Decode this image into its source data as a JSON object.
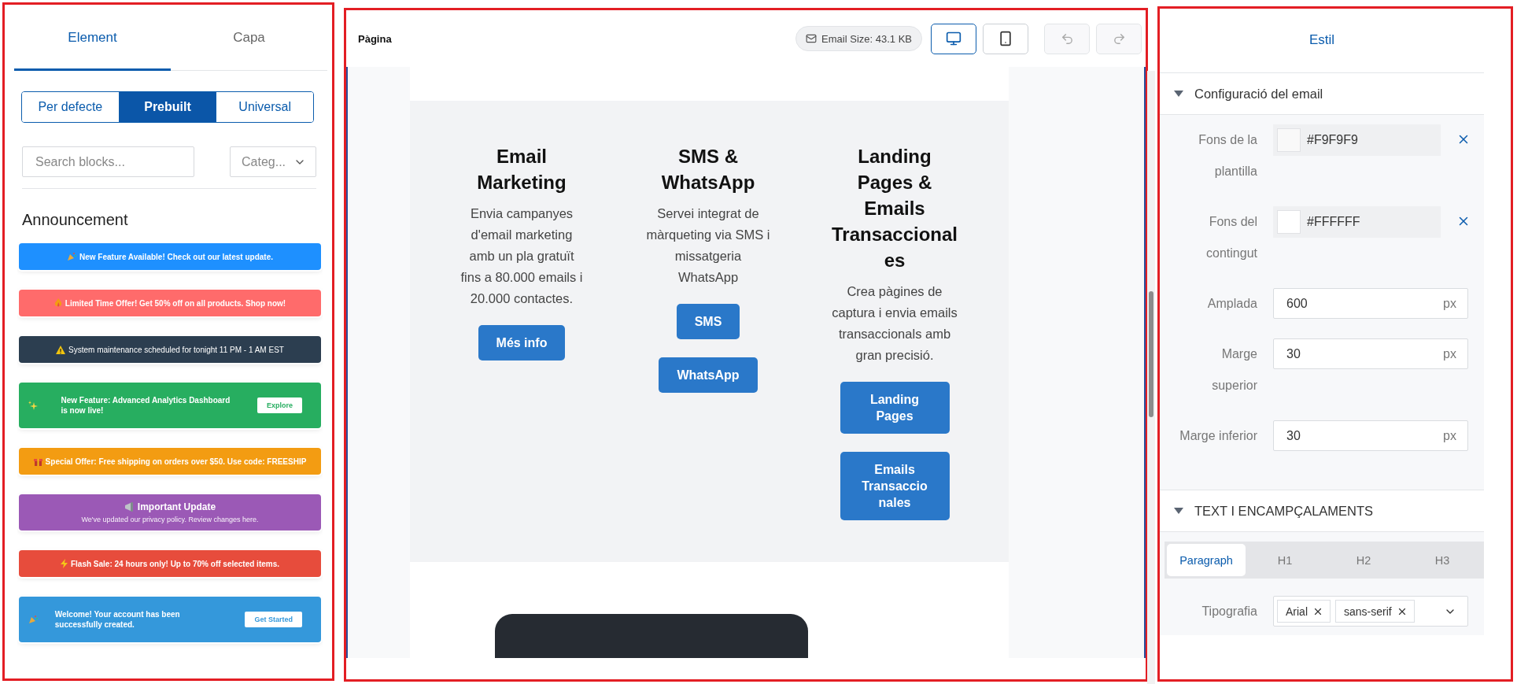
{
  "left_panel": {
    "tabs": [
      {
        "label": "Element",
        "selected": true
      },
      {
        "label": "Capa",
        "selected": false
      }
    ],
    "block_sources": [
      {
        "label": "Per defecte",
        "selected": false
      },
      {
        "label": "Prebuilt",
        "selected": true
      },
      {
        "label": "Universal",
        "selected": false
      }
    ],
    "search": {
      "placeholder": "Search blocks..."
    },
    "category_select": {
      "placeholder": "Categ..."
    },
    "section_title": "Announcement",
    "blocks": [
      {
        "kind": "bar",
        "color": "#1e90ff",
        "bold": true,
        "text": "New Feature Available! Check out our latest update."
      },
      {
        "kind": "bar",
        "color": "#ff6b6b",
        "bold": true,
        "text": "Limited Time Offer! Get 50% off on all products. Shop now!"
      },
      {
        "kind": "bar",
        "color": "#2c3e50",
        "bold": false,
        "text": "System maintenance scheduled for tonight 11 PM - 1 AM EST"
      },
      {
        "kind": "cta",
        "color": "#27ae60",
        "bold": true,
        "text": "New Feature: Advanced Analytics Dashboard is now live!",
        "button": "Explore"
      },
      {
        "kind": "bar",
        "color": "#f39c12",
        "bold": true,
        "text": "Special Offer: Free shipping on orders over $50. Use code: FREESHIP"
      },
      {
        "kind": "titled",
        "color": "#9b59b6",
        "bold": true,
        "text": "Important Update",
        "subtitle": "We've updated our privacy policy. Review changes here."
      },
      {
        "kind": "bar",
        "color": "#e74c3c",
        "bold": true,
        "text": "Flash Sale: 24 hours only! Up to 70% off selected items."
      },
      {
        "kind": "cta",
        "color": "#3498db",
        "bold": true,
        "text": "Welcome! Your account has been successfully created.",
        "button": "Get Started"
      }
    ]
  },
  "canvas": {
    "title": "Pàgina",
    "email_size": "Email Size: 43.1 KB",
    "view_modes": [
      {
        "kind": "desktop",
        "selected": true
      },
      {
        "kind": "mobile",
        "selected": false
      }
    ],
    "history_buttons": [
      {
        "kind": "undo",
        "disabled": true
      },
      {
        "kind": "redo",
        "disabled": true
      }
    ],
    "email_columns": [
      {
        "title": "Email Marketing",
        "text": "Envia campanyes d'email marketing amb un pla gratuït fins a 80.000 emails i 20.000 contactes.",
        "buttons": [
          "Més info"
        ]
      },
      {
        "title": "SMS & WhatsApp",
        "text": "Servei integrat de màrqueting via SMS i missatgeria WhatsApp",
        "buttons": [
          "SMS",
          "WhatsApp"
        ]
      },
      {
        "title": "Landing Pages & Emails Transaccionales",
        "text": "Crea pàgines de captura i envia emails transaccionals amb gran precisió.",
        "buttons": [
          "Landing Pages",
          "Emails Transaccionales"
        ]
      }
    ]
  },
  "right_panel": {
    "tabs": [
      {
        "label": "Estil",
        "selected": true
      }
    ],
    "sections": [
      {
        "title": "Configuració del email",
        "expanded": true,
        "fields": [
          {
            "kind": "color",
            "label": "Fons de la plantilla",
            "value": "#F9F9F9"
          },
          {
            "kind": "color",
            "label": "Fons del contingut",
            "value": "#FFFFFF"
          },
          {
            "kind": "number",
            "label": "Amplada",
            "value": "600",
            "unit": "px"
          },
          {
            "kind": "number",
            "label": "Marge superior",
            "value": "30",
            "unit": "px"
          },
          {
            "kind": "number",
            "label": "Marge inferior",
            "value": "30",
            "unit": "px"
          }
        ]
      },
      {
        "title": "TEXT I ENCAMPÇALAMENTS",
        "expanded": true,
        "tabs": [
          {
            "label": "Paragraph",
            "selected": true
          },
          {
            "label": "H1",
            "selected": false
          },
          {
            "label": "H2",
            "selected": false
          },
          {
            "label": "H3",
            "selected": false
          }
        ],
        "fields": [
          {
            "kind": "font",
            "label": "Tipografia",
            "tags": [
              "Arial",
              "sans-serif"
            ]
          }
        ]
      }
    ]
  }
}
